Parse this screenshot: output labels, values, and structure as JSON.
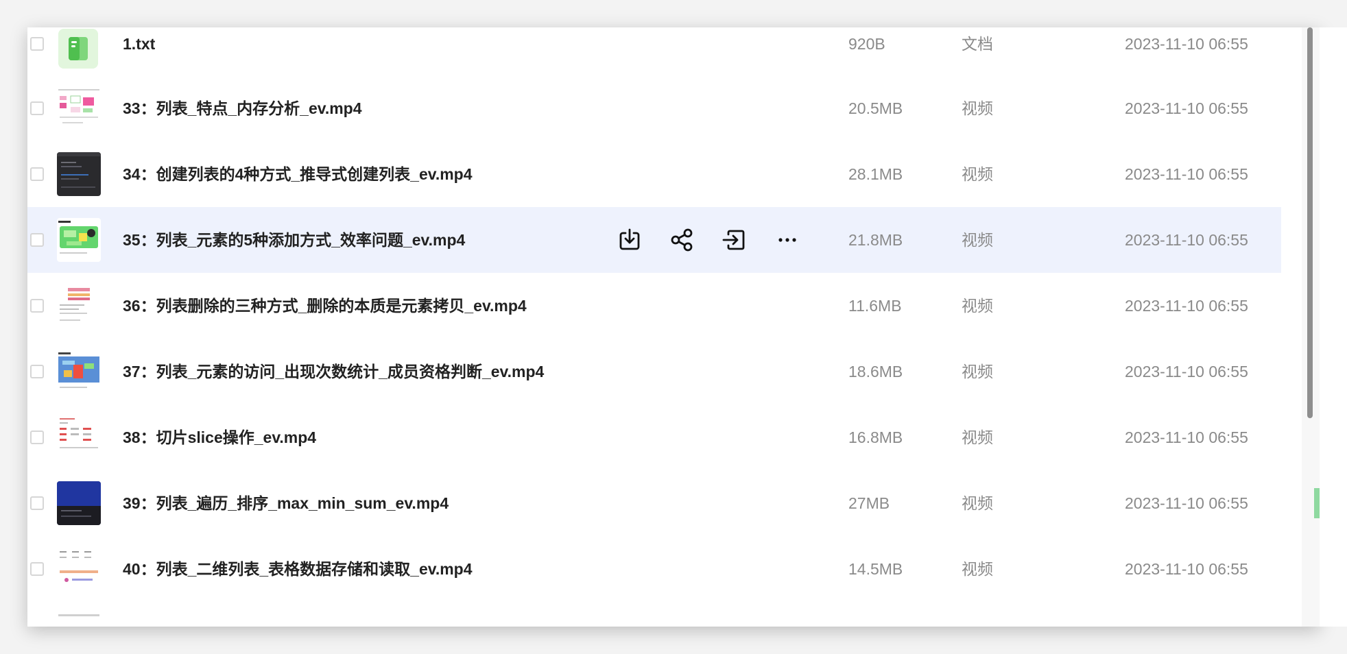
{
  "files": [
    {
      "name": "1.txt",
      "size": "920B",
      "type": "文档",
      "date": "2023-11-10 06:55",
      "thumbnail": "document-icon",
      "partial_top": true
    },
    {
      "name": "33：列表_特点_内存分析_ev.mp4",
      "size": "20.5MB",
      "type": "视频",
      "date": "2023-11-10 06:55",
      "thumbnail": "video-thumb-diagram"
    },
    {
      "name": "34：创建列表的4种方式_推导式创建列表_ev.mp4",
      "size": "28.1MB",
      "type": "视频",
      "date": "2023-11-10 06:55",
      "thumbnail": "video-thumb-dark-editor"
    },
    {
      "name": "35：列表_元素的5种添加方式_效率问题_ev.mp4",
      "size": "21.8MB",
      "type": "视频",
      "date": "2023-11-10 06:55",
      "thumbnail": "video-thumb-green",
      "hovered": true
    },
    {
      "name": "36：列表删除的三种方式_删除的本质是元素拷贝_ev.mp4",
      "size": "11.6MB",
      "type": "视频",
      "date": "2023-11-10 06:55",
      "thumbnail": "video-thumb-list"
    },
    {
      "name": "37：列表_元素的访问_出现次数统计_成员资格判断_ev.mp4",
      "size": "18.6MB",
      "type": "视频",
      "date": "2023-11-10 06:55",
      "thumbnail": "video-thumb-colorful"
    },
    {
      "name": "38：切片slice操作_ev.mp4",
      "size": "16.8MB",
      "type": "视频",
      "date": "2023-11-10 06:55",
      "thumbnail": "video-thumb-table"
    },
    {
      "name": "39：列表_遍历_排序_max_min_sum_ev.mp4",
      "size": "27MB",
      "type": "视频",
      "date": "2023-11-10 06:55",
      "thumbnail": "video-thumb-dark-blue"
    },
    {
      "name": "40：列表_二维列表_表格数据存储和读取_ev.mp4",
      "size": "14.5MB",
      "type": "视频",
      "date": "2023-11-10 06:55",
      "thumbnail": "video-thumb-grid"
    }
  ],
  "hover_actions": [
    "download-icon",
    "share-icon",
    "move-icon",
    "more-icon"
  ],
  "colors": {
    "hover_row": "#eef2fd",
    "filename": "#222222",
    "meta_text": "#8a8a8a",
    "doc_icon_bg": "#e2f6dd",
    "doc_icon_fg": "#5ccb5f"
  }
}
